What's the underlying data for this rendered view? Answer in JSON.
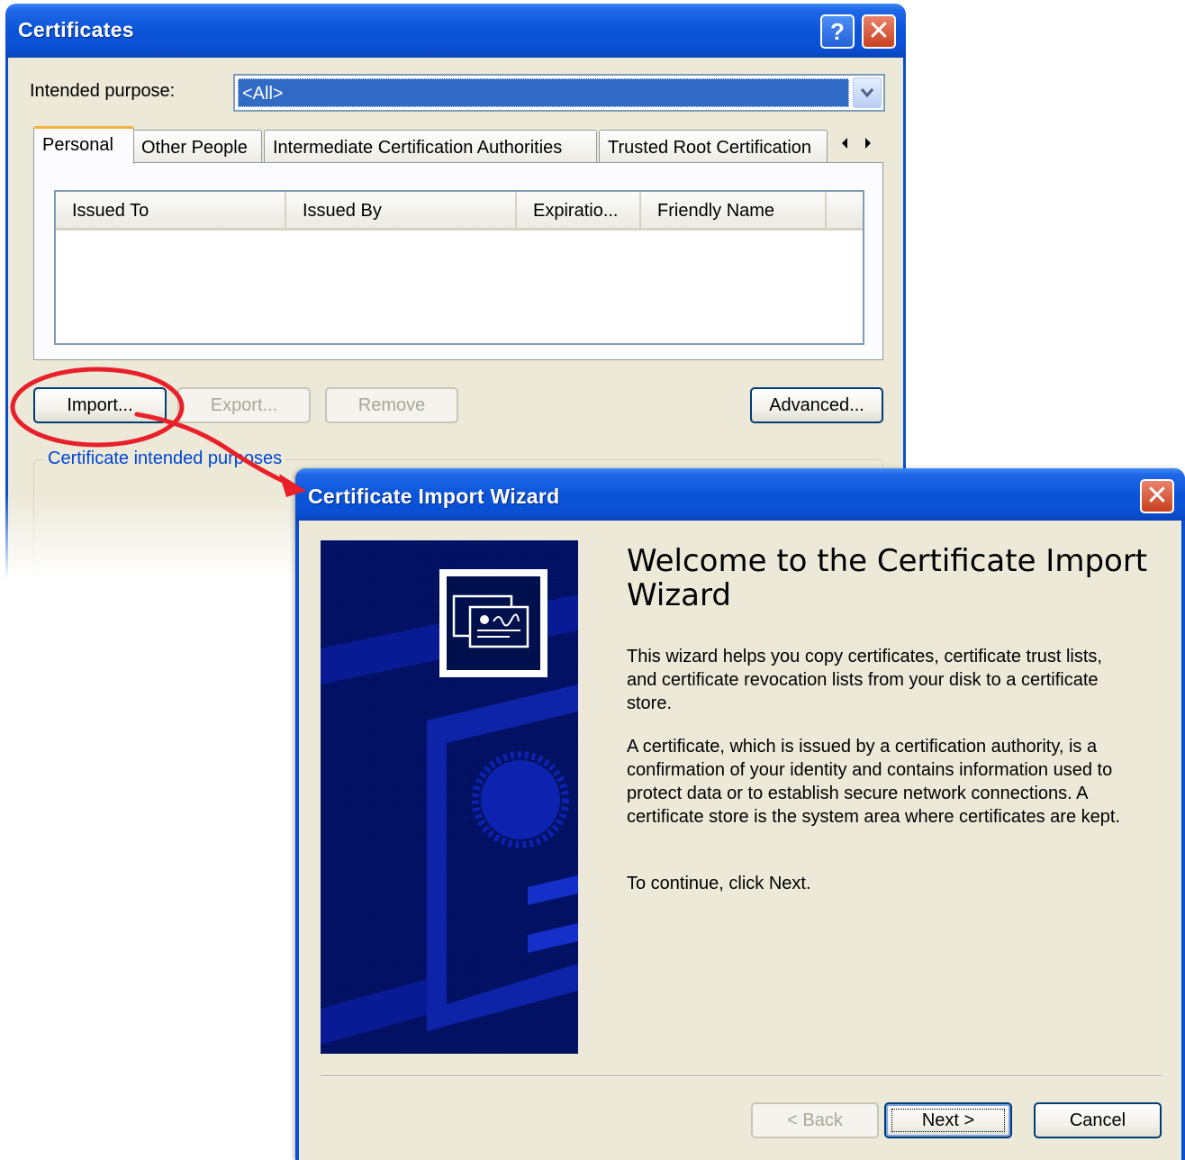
{
  "certificates": {
    "title": "Certificates",
    "help_icon": "question-mark",
    "close_icon": "close-x",
    "purpose_label": "Intended purpose:",
    "purpose_value": "<All>",
    "tabs": [
      "Personal",
      "Other People",
      "Intermediate Certification Authorities",
      "Trusted Root Certification"
    ],
    "columns": [
      "Issued To",
      "Issued By",
      "Expiratio...",
      "Friendly Name"
    ],
    "buttons": {
      "import": "Import...",
      "export": "Export...",
      "remove": "Remove",
      "advanced": "Advanced..."
    },
    "purposes_group": "Certificate intended purposes"
  },
  "wizard": {
    "title": "Certificate Import Wizard",
    "heading": "Welcome to the Certificate Import Wizard",
    "para1": "This wizard helps you copy certificates, certificate trust lists, and certificate revocation lists from your disk to a certificate store.",
    "para2": "A certificate, which is issued by a certification authority, is a confirmation of your identity and contains information used to protect data or to establish secure network connections. A certificate store is the system area where certificates are kept.",
    "para3": "To continue, click Next.",
    "buttons": {
      "back": "< Back",
      "next": "Next >",
      "cancel": "Cancel"
    }
  },
  "colors": {
    "xp_blue": "#0a55d8",
    "window_face": "#ece9d8",
    "selection": "#316ac5",
    "annotation_red": "#e8202a",
    "group_label": "#0046d5",
    "wizard_art": "#000e5c"
  }
}
